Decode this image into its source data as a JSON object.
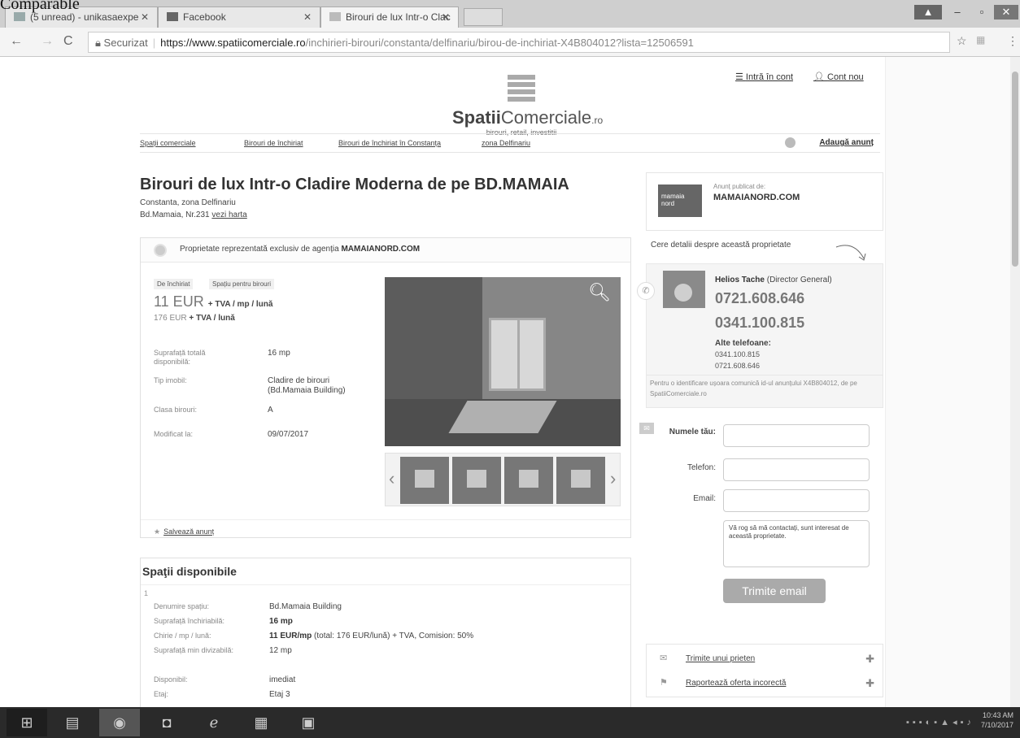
{
  "top_label": "Comparable",
  "browser": {
    "tabs": [
      {
        "label": "(5 unread) - unikasaexpe"
      },
      {
        "label": "Facebook"
      },
      {
        "label": "Birouri de lux Intr-o Clac"
      }
    ],
    "url_secure": "Securizat",
    "url_domain": "https://www.spatiicomerciale.ro",
    "url_path": "/inchirieri-birouri/constanta/delfinariu/birou-de-inchiriat-X4B804012?lista=12506591"
  },
  "header": {
    "login": "Intră în cont",
    "new_account": "Cont nou",
    "logo_name_bold": "Spatii",
    "logo_name_rest": "Comerciale",
    "logo_suffix": ".ro",
    "logo_tagline": "birouri, retail, investitii"
  },
  "breadcrumbs": [
    "Spații comerciale",
    "Birouri de închiriat",
    "Birouri de închiriat în Constanța",
    "zona Delfinariu"
  ],
  "add_ad": "Adaugă anunț",
  "listing": {
    "title": "Birouri de lux Intr-o Cladire Moderna de pe BD.MAMAIA",
    "location": "Constanta, zona Delfinariu",
    "address": "Bd.Mamaia, Nr.231",
    "map_link": "vezi harta",
    "agency_note": "Proprietate reprezentată exclusiv de agenția",
    "agency_name": "MAMAIANORD.COM",
    "tag_rent": "De închiriat",
    "tag_type": "Spațiu pentru birouri",
    "price_main": "11 EUR",
    "price_main_unit": "+ TVA / mp / lună",
    "price_total": "176 EUR",
    "price_total_unit": "+ TVA / lună",
    "props": [
      {
        "label": "Suprafață totală disponibilă:",
        "value": "16 mp"
      },
      {
        "label": "Tip imobil:",
        "value": "Cladire de birouri (Bd.Mamaia Building)"
      },
      {
        "label": "Clasa birouri:",
        "value": "A"
      },
      {
        "label": "Modificat la:",
        "value": "09/07/2017"
      }
    ],
    "save": "Salvează anunț"
  },
  "spaces": {
    "title": "Spaţii disponibile",
    "index": "1",
    "rows": [
      {
        "label": "Denumire spațiu:",
        "value": "Bd.Mamaia Building"
      },
      {
        "label": "Suprafață închiriabilă:",
        "value": "16 mp"
      },
      {
        "label": "Chirie / mp / lună:",
        "value_bold": "11 EUR/mp",
        "value": "(total: 176 EUR/lună) + TVA, Comision: 50%"
      },
      {
        "label": "Suprafață min divizabilă:",
        "value": "12 mp"
      },
      {
        "label": "Disponibil:",
        "value": "imediat"
      },
      {
        "label": "Etaj:",
        "value": "Etaj 3"
      }
    ]
  },
  "sidebar": {
    "published_by": "Anunț publicat de:",
    "agency": "MAMAIANORD.COM",
    "logo_text_1": "mamaia",
    "logo_text_2": "nord",
    "ask": "Cere detalii despre această proprietate",
    "contact_name": "Helios Tache",
    "contact_role": "(Director General)",
    "phone_1": "0721.608.646",
    "phone_2": "0341.100.815",
    "alt_label": "Alte telefoane:",
    "alt_1": "0341.100.815",
    "alt_2": "0721.608.646",
    "id_note": "Pentru o identificare ușoara comunică id-ul anunțului X4B804012, de pe SpatiiComerciale.ro",
    "form": {
      "name_label": "Numele tău:",
      "phone_label": "Telefon:",
      "email_label": "Email:",
      "message": "Vă rog să mă contactați, sunt interesat de această proprietate.",
      "send": "Trimite email"
    },
    "links": [
      "Trimite unui prieten",
      "Raportează oferta incorectă"
    ]
  },
  "taskbar": {
    "time": "10:43 AM",
    "date": "7/10/2017"
  }
}
